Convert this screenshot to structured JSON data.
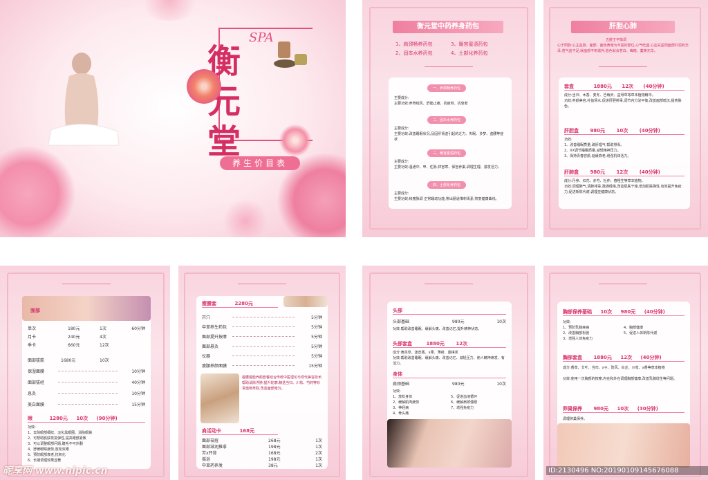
{
  "cover": {
    "logo_spa": "SPA",
    "brand": "衡元堂",
    "subtitle": "养生价目表"
  },
  "panel2": {
    "title": "衡元堂中药养身药包",
    "items": [
      "1、肩颈畅养药包",
      "2、固本水养药包",
      "3、暖宫蜜语药包",
      "4、土部化养药包"
    ],
    "sections": [
      {
        "pill": "一、肩颈畅养药包",
        "lines": [
          "主要成分:",
          "主要功效:养骨结风、舒筋止痛、抗疲劳、抗衰老"
        ]
      },
      {
        "pill": "二、固本水养药包",
        "lines": [
          "主要成分:",
          "主要功效:改善睡眠状况,及因肝肾虚引起的乏力、失眠、多梦、盗腰等症状"
        ]
      },
      {
        "pill": "三、暖宫蜜语药包",
        "lines": [
          "主要成分:",
          "主要功效:温通中、甲、任脉,祥宫寒、保宫养巢,调理生理、激发活力。"
        ]
      },
      {
        "pill": "四、土部化养药包",
        "lines": [
          "主要成分:",
          "主要功效:帐瘦脉调 正常蠕动功能,排出肠道堆积毒素,恢复健康曲线。"
        ]
      }
    ]
  },
  "panel3": {
    "title": "肝胆心肺",
    "intro": [
      "五脏王平衡调",
      "心于阳脉:心主血脉、面部、面色黄暗为丰富的部位,心气旺盛,心血充盈则面部红润有光泽,若气血不足,就面部不到滋养,脸色就会苍白、晦暗、萎黄无华。"
    ],
    "blocks": [
      {
        "name": "套盒",
        "price": "1880元",
        "times": "12次",
        "dur": "(40分钟)",
        "lines": [
          "成分:当归、木香、麦冬、巴戟天、益母草等草本植物精华。",
          "功效:养颜美容,补益肾水,促进肝胆排毒,调节内分泌平衡,改善面部暗沉,提亮肤色。"
        ]
      },
      {
        "name": "肝胆盒",
        "price": "980元",
        "times": "10次",
        "dur": "(40分钟)",
        "lines": [
          "功效:",
          "1、改善睡眠质量,疏肝理气,帮助排毒。",
          "2、XX调节睡眠质量,减轻精神压力。",
          "3、保持青春容颜,延缓衰老,增强机体活力。"
        ]
      },
      {
        "name": "肝肺盒",
        "price": "980元",
        "times": "12次",
        "dur": "(40分钟)",
        "lines": [
          "成分:丹参、红花、赤芍、杜仲、春橙生等草本植物。",
          "功效:调理肺气,清肺排毒,疏通经络,改善肌肤干燥,增加肌肤弹性,有效提升免疫力,促进新陈代谢,调理亚健康状态。"
        ]
      }
    ]
  },
  "panel4": {
    "title": "面部",
    "rows": [
      {
        "name": "单次",
        "price": "180元",
        "count": "1次",
        "dur": "60分钟"
      },
      {
        "name": "月卡",
        "price": "240元",
        "count": "4次",
        "dur": ""
      },
      {
        "name": "季卡",
        "price": "660元",
        "count": "12次",
        "dur": ""
      }
    ],
    "rows2": [
      {
        "name": "面部拔筋",
        "price": "1680元",
        "count": "10次",
        "dur": ""
      },
      {
        "name": "保湿面膜",
        "price": "",
        "count": "",
        "dur": "10分钟"
      },
      {
        "name": "面部拔经",
        "price": "",
        "count": "",
        "dur": "40分钟"
      },
      {
        "name": "息灸",
        "price": "",
        "count": "",
        "dur": "10分钟"
      },
      {
        "name": "美白面膜",
        "price": "",
        "count": "",
        "dur": "15分钟"
      }
    ],
    "bottom": {
      "name": "眼",
      "price": "1280元",
      "times": "10次",
      "dur": "(90分钟)"
    },
    "bottom_lines": [
      "功效:",
      "1、去除眼部细纹、淡化黑眼圈、消除眼袋",
      "2、可帮助肌肤恢复弹性,提高眼部紧致",
      "3、可以调整眼部问题,睫毛不可外翻",
      "4、舒缓眼睛疲劳,放松双眼",
      "5、预防眼部衰老,抗氧化",
      "6、长期调理效果显著"
    ]
  },
  "panel5": {
    "title": "瘦腰套",
    "price": "2280元",
    "rows": [
      {
        "name": "开穴",
        "dur": "5分钟"
      },
      {
        "name": "中草养生药包",
        "dur": "5分钟"
      },
      {
        "name": "面部提升按摩",
        "dur": "5分钟"
      },
      {
        "name": "面部悬灸",
        "dur": "5分钟"
      },
      {
        "name": "仪器",
        "dur": "5分钟"
      },
      {
        "name": "瘦腰养颜面膜",
        "dur": "15分钟"
      }
    ],
    "note": "瘦腰瘦脸养颜套餐结合传统中医理论与现代美容技术,帮助消除浮肿,提升轮廓,精选当归、川芎、芍药等珍贵植物萃取,改善面部暗沉。",
    "title2": "肩活动卡",
    "price2": "168元",
    "rows2": [
      {
        "name": "面部祛痘",
        "price": "268元",
        "count": "1次"
      },
      {
        "name": "面部滋润推拿",
        "price": "198元",
        "count": "1次"
      },
      {
        "name": "芳x开背",
        "price": "168元",
        "count": "2次"
      },
      {
        "name": "摇浴",
        "price": "198元",
        "count": "1次"
      },
      {
        "name": "中草药养发",
        "price": "38元",
        "count": "1次"
      }
    ]
  },
  "panel6": {
    "t1": "头部",
    "r1": {
      "name": "头部基础",
      "price": "980元",
      "count": "10次"
    },
    "l1": [
      "功效:帮助改善睡眠、缓解头痛、改善记忆,提升精神状态。"
    ],
    "t2": "头部套盒",
    "r2": {
      "price": "1880元",
      "count": "12次"
    },
    "l2": [
      "成分:黄芪草、迷迭香、x果、薄荷、桑棋茶",
      "功效:帮助改善睡眠、缓解头痛、改善记忆、减轻压力、使人精神焕发、有活力。"
    ],
    "t3": "身体",
    "r3": {
      "name": "肩颈基础",
      "price": "980元",
      "count": "10次"
    },
    "l3": [
      "功效:",
      "1、放松身体",
      "2、缓解肌肉疲劳",
      "3、神经病",
      "4、骨头痛",
      "5、促进血液循环",
      "6、缓解肩颈僵硬",
      "7、增强免疫力"
    ]
  },
  "panel7": {
    "t1": "胸部保养基础",
    "r1": {
      "count": "10次",
      "price": "980元",
      "dur": "(40分钟)"
    },
    "l1": [
      "功效:",
      "1、预防乳腺疾病",
      "2、改善胸部松弛",
      "3、增强人体免疫力",
      "4、胸部健康",
      "5、促进人体新陈代谢"
    ],
    "t2": "胸部套盒",
    "r2": {
      "price": "1880元",
      "count": "12次",
      "dur": "(40分钟)"
    },
    "l2": [
      "成分:香草、艾叶、当归、x子、防风、白芷、川芎、x香等草本植物",
      "功效:使用一次胸部的按摩,内在和外在调理胸部健康,改善乳腺增生等问题。"
    ],
    "t3": "卵巢保养",
    "r3": {
      "price": "980元",
      "count": "10次",
      "dur": "(30分钟)"
    },
    "l3": [
      "调理卵巢保养。"
    ]
  },
  "watermark": {
    "left": "昵享网 www.nipic.cn",
    "right": "ID:2130496 NO:20190109145676088"
  }
}
